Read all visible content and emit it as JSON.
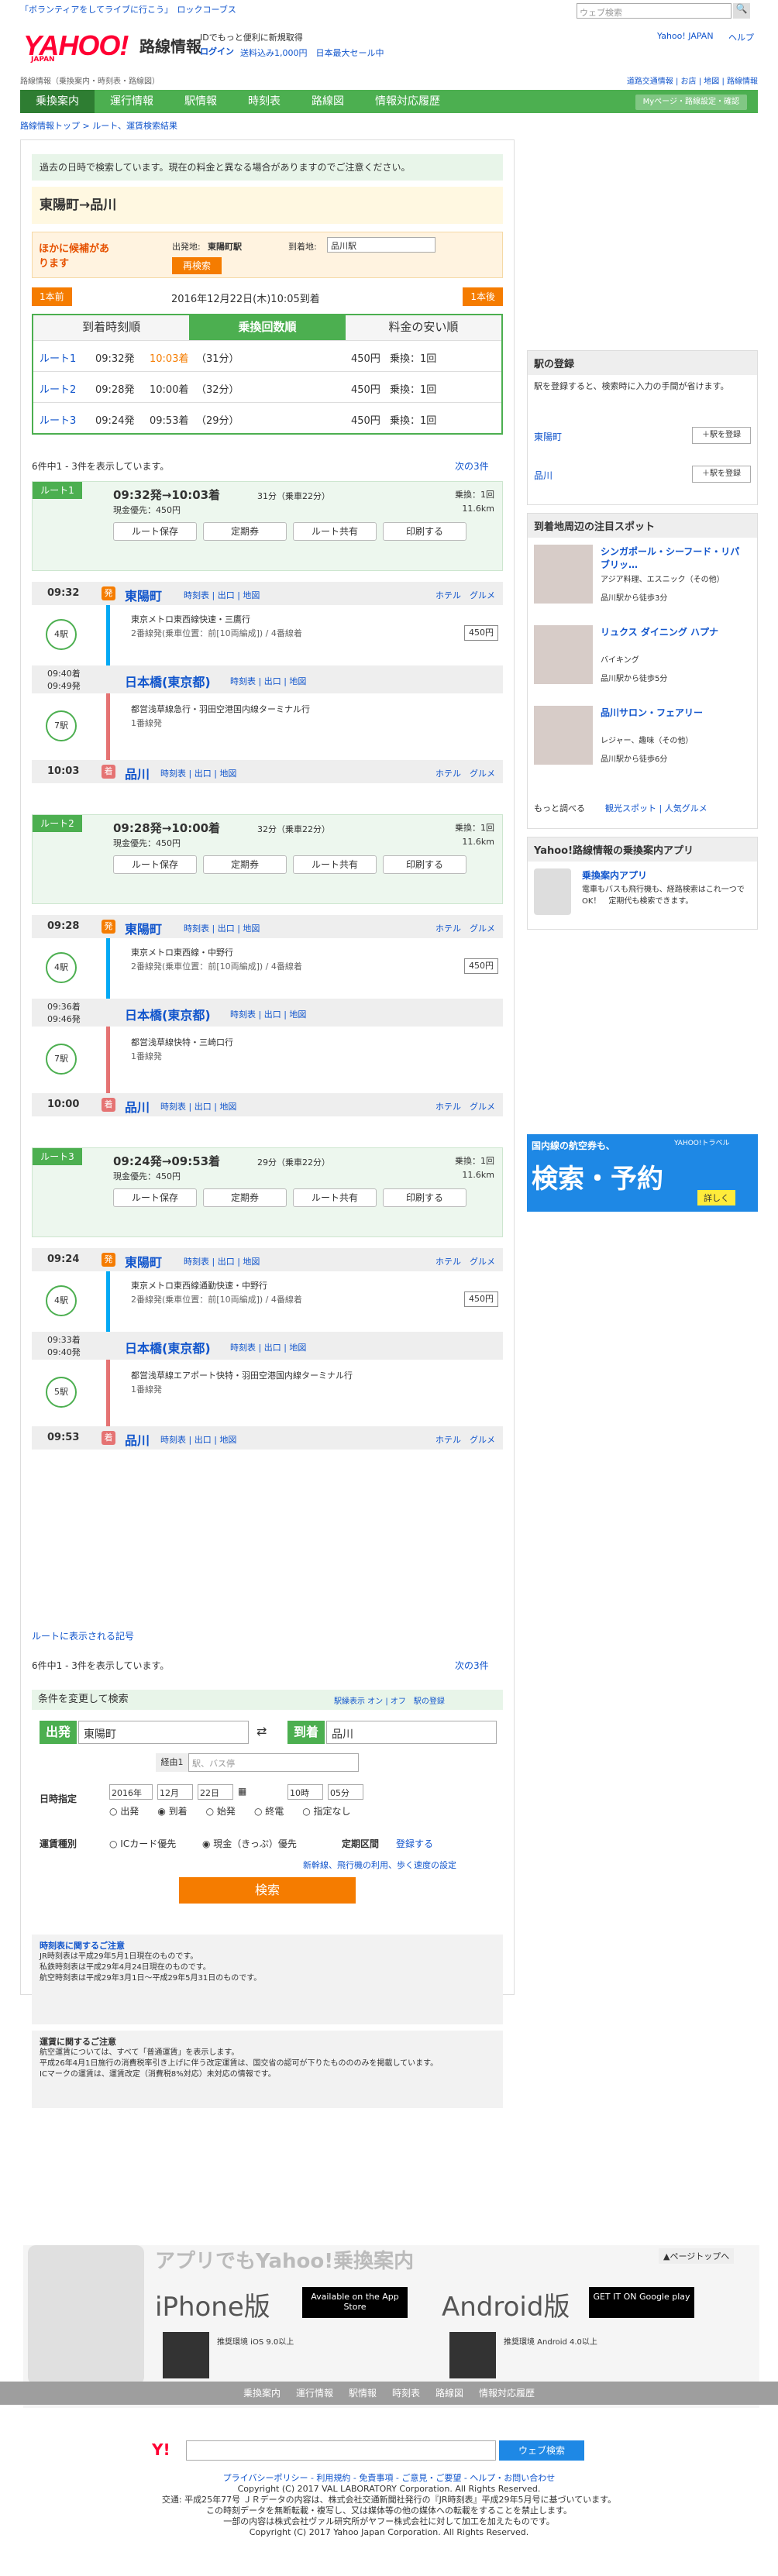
{
  "header": {
    "search_placeholder": "ウェブ検索",
    "yahoo_link": "Yahoo! JAPAN",
    "help_link": "ヘルプ",
    "top_promo": "「ボランティアをしてライブに行こう」　ロックコーブス",
    "logo": "YAHOO!",
    "logo_sub": "JAPAN",
    "service": "路線情報",
    "promo_line1": "IDでもっと便利に新規取得",
    "promo_login": "ログイン",
    "promo_line2": "送料込み1,000円　日本最大セール中",
    "subnav": "路線情報（乗換案内・時刻表・路線図）",
    "right_links": "道路交通情報 | お店 | 地図 | 路線情報"
  },
  "nav": {
    "items": [
      "乗換案内",
      "運行情報",
      "駅情報",
      "時刻表",
      "路線図",
      "情報対応履歴"
    ],
    "mypage": "Myページ・路線設定・確認"
  },
  "crumb": "路線情報トップ > ルート、運賃検索結果",
  "notice": "過去の日時で検索しています。現在の料金と異なる場合がありますのでご注意ください。",
  "od": {
    "from": "東陽町",
    "arrow": "→",
    "to": "品川"
  },
  "candidate": {
    "label": "ほかに候補があります",
    "from_label": "出発地:",
    "from": "東陽町駅",
    "to_label": "到着地:",
    "to": "品川駅",
    "research": "再検索"
  },
  "datebar": {
    "prev": "1本前",
    "date": "2016年12月22日(木)10:05到着",
    "next": "1本後"
  },
  "tabs": [
    "到着時刻順",
    "乗換回数順",
    "料金の安い順"
  ],
  "routes_summary": [
    {
      "label": "ルート1",
      "dep": "09:32発",
      "arr": "10:03着",
      "dur": "（31分）",
      "fare": "450円",
      "xfer": "乗換：1回"
    },
    {
      "label": "ルート2",
      "dep": "09:28発",
      "arr": "10:00着",
      "dur": "（32分）",
      "fare": "450円",
      "xfer": "乗換：1回"
    },
    {
      "label": "ルート3",
      "dep": "09:24発",
      "arr": "09:53着",
      "dur": "（29分）",
      "fare": "450円",
      "xfer": "乗換：1回"
    }
  ],
  "count": "6件中1 - 3件を表示しています。",
  "next3": "次の3件",
  "buttons": [
    "ルート保存",
    "定期券",
    "ルート共有",
    "印刷する"
  ],
  "routes": [
    {
      "tag": "ルート1",
      "head": "09:32発→10:03着",
      "dur": "31分（乗車22分）",
      "xfer": "乗換：1回",
      "fare": "現金優先：450円",
      "km": "11.6km",
      "s1": {
        "time": "09:32",
        "name": "東陽町",
        "links": "時刻表 | 出口 | 地図"
      },
      "t1": "東京メトロ東西線快速・三鷹行",
      "t1b": "2番線発(乗車位置：前[10両編成]) / 4番線着",
      "min1": "4駅",
      "s2": {
        "time1": "09:40着",
        "time2": "09:49発",
        "name": "日本橋(東京都)",
        "links": "時刻表 | 出口 | 地図"
      },
      "t2": "都営浅草線急行・羽田空港国内線ターミナル行",
      "t2b": "1番線発",
      "min2": "7駅",
      "s3": {
        "time": "10:03",
        "name": "品川",
        "links": "時刻表 | 出口 | 地図"
      }
    },
    {
      "tag": "ルート2",
      "head": "09:28発→10:00着",
      "dur": "32分（乗車22分）",
      "xfer": "乗換：1回",
      "fare": "現金優先：450円",
      "km": "11.6km",
      "s1": {
        "time": "09:28",
        "name": "東陽町",
        "links": "時刻表 | 出口 | 地図"
      },
      "t1": "東京メトロ東西線・中野行",
      "t1b": "2番線発(乗車位置：前[10両編成]) / 4番線着",
      "min1": "4駅",
      "s2": {
        "time1": "09:36着",
        "time2": "09:46発",
        "name": "日本橋(東京都)",
        "links": "時刻表 | 出口 | 地図"
      },
      "t2": "都営浅草線快特・三崎口行",
      "t2b": "1番線発",
      "min2": "7駅",
      "s3": {
        "time": "10:00",
        "name": "品川",
        "links": "時刻表 | 出口 | 地図"
      }
    },
    {
      "tag": "ルート3",
      "head": "09:24発→09:53着",
      "dur": "29分（乗車22分）",
      "xfer": "乗換：1回",
      "fare": "現金優先：450円",
      "km": "11.6km",
      "s1": {
        "time": "09:24",
        "name": "東陽町",
        "links": "時刻表 | 出口 | 地図"
      },
      "t1": "東京メトロ東西線通勤快速・中野行",
      "t1b": "2番線発(乗車位置：前[10両編成]) / 4番線着",
      "min1": "4駅",
      "s2": {
        "time1": "09:33着",
        "time2": "09:40発",
        "name": "日本橋(東京都)",
        "links": "時刻表 | 出口 | 地図"
      },
      "t2": "都営浅草線エアポート快特・羽田空港国内線ターミナル行",
      "t2b": "1番線発",
      "min2": "5駅",
      "s3": {
        "time": "09:53",
        "name": "品川",
        "links": "時刻表 | 出口 | 地図"
      }
    }
  ],
  "route_fare": "450円",
  "hotel": "ホテル",
  "gourmet": "グルメ",
  "dep_mark": "発",
  "arr_mark": "着",
  "legend_link": "ルートに表示される記号",
  "search": {
    "title": "条件を変更して検索",
    "opts": "駅繰表示 オン | オフ　駅の登録",
    "from_label": "出発",
    "from": "東陽町",
    "to_label": "到着",
    "to": "品川",
    "via_label": "経由1",
    "via_ph": "駅、バス停",
    "date_label": "日時指定",
    "y": "2016年",
    "m": "12月",
    "d": "22日",
    "h": "10時",
    "mi": "05分",
    "radios": [
      "出発",
      "到着",
      "始発",
      "終電",
      "指定なし"
    ],
    "fare_label": "運賃種別",
    "ic": "ICカード優先",
    "cash": "現金（きっぷ）優先",
    "pass_label": "定期区間",
    "pass_reg": "登録する",
    "detail": "新幹線、飛行機の利用、歩く速度の設定",
    "submit": "検索"
  },
  "notes": {
    "h1": "時刻表に関するご注意",
    "l1": [
      "JR時刻表は平成29年5月1日現在のものです。",
      "私鉄時刻表は平成29年4月24日現在のものです。",
      "航空時刻表は平成29年3月1日～平成29年5月31日のものです。"
    ],
    "h2": "運賃に関するご注意",
    "l2": [
      "航空運賃については、すべて「普通運賃」を表示します。",
      "平成26年4月1日施行の消費税率引き上げに伴う改定運賃は、国交省の認可が下りたものののみを掲載しています。",
      "ICマークの運賃は、運賃改定（消費税8%対応）未対応の情報です。"
    ]
  },
  "side": {
    "reg_title": "駅の登録",
    "reg_desc": "駅を登録すると、検索時に入力の手間が省けます。",
    "st1": "東陽町",
    "st2": "品川",
    "reg_btn": "駅を登録",
    "spot_title": "到着地周辺の注目スポット",
    "spots": [
      {
        "name": "シンガポール・シーフード・リパブリッ…",
        "cat": "アジア料理、エスニック（その他）",
        "walk": "品川駅から徒歩3分"
      },
      {
        "name": "リュクス ダイニング ハプナ",
        "cat": "バイキング",
        "walk": "品川駅から徒歩5分"
      },
      {
        "name": "品川サロン・フェアリー",
        "cat": "レジャー、趣味（その他）",
        "walk": "品川駅から徒歩6分"
      }
    ],
    "more": "もっと調べる",
    "more_links": "観光スポット | 人気グルメ",
    "app_title": "Yahoo!路線情報の乗換案内アプリ",
    "app_name": "乗換案内アプリ",
    "app_desc": "電車もバスも飛行機も、経路検索はこれ一つでOK！　定期代も検索できます。",
    "ad_top": "国内線の航空券も、",
    "ad_main": "検索・予約",
    "ad_btn": "詳しく",
    "ad_brand": "YAHOO!トラベル"
  },
  "app_footer": {
    "title": "アプリでもYahoo!乗換案内",
    "iphone": "iPhone版",
    "appstore": "Available on the App Store",
    "android": "Android版",
    "gplay": "GET IT ON Google play",
    "ios_note": "推奨環境 iOS 9.0以上",
    "and_note": "推奨環境 Android 4.0以上",
    "pagetop": "ページトップへ"
  },
  "fnav": [
    "乗換案内",
    "運行情報",
    "駅情報",
    "時刻表",
    "路線図",
    "情報対応履歴"
  ],
  "fsearch_btn": "ウェブ検索",
  "fbottom": [
    "プライバシーポリシー - 利用規約 - 免責事項 - ご意見・ご要望 - ヘルプ・お問い合わせ",
    "Copyright (C) 2017 VAL LABORATORY Corporation. All Rights Reserved.",
    "交通: 平成25年77号 ＪＲデータの内容は、株式会社交通新聞社発行の『JR時刻表』平成29年5月号に基づいています。",
    "この時刻データを無断転載・複写し、又は媒体等の他の媒体への転載をすることを禁止します。",
    "一部の内容は株式会社ヴァル研究所がヤフー株式会社に対して加工を加えたものです。",
    "Copyright (C) 2017 Yahoo Japan Corporation. All Rights Reserved."
  ]
}
